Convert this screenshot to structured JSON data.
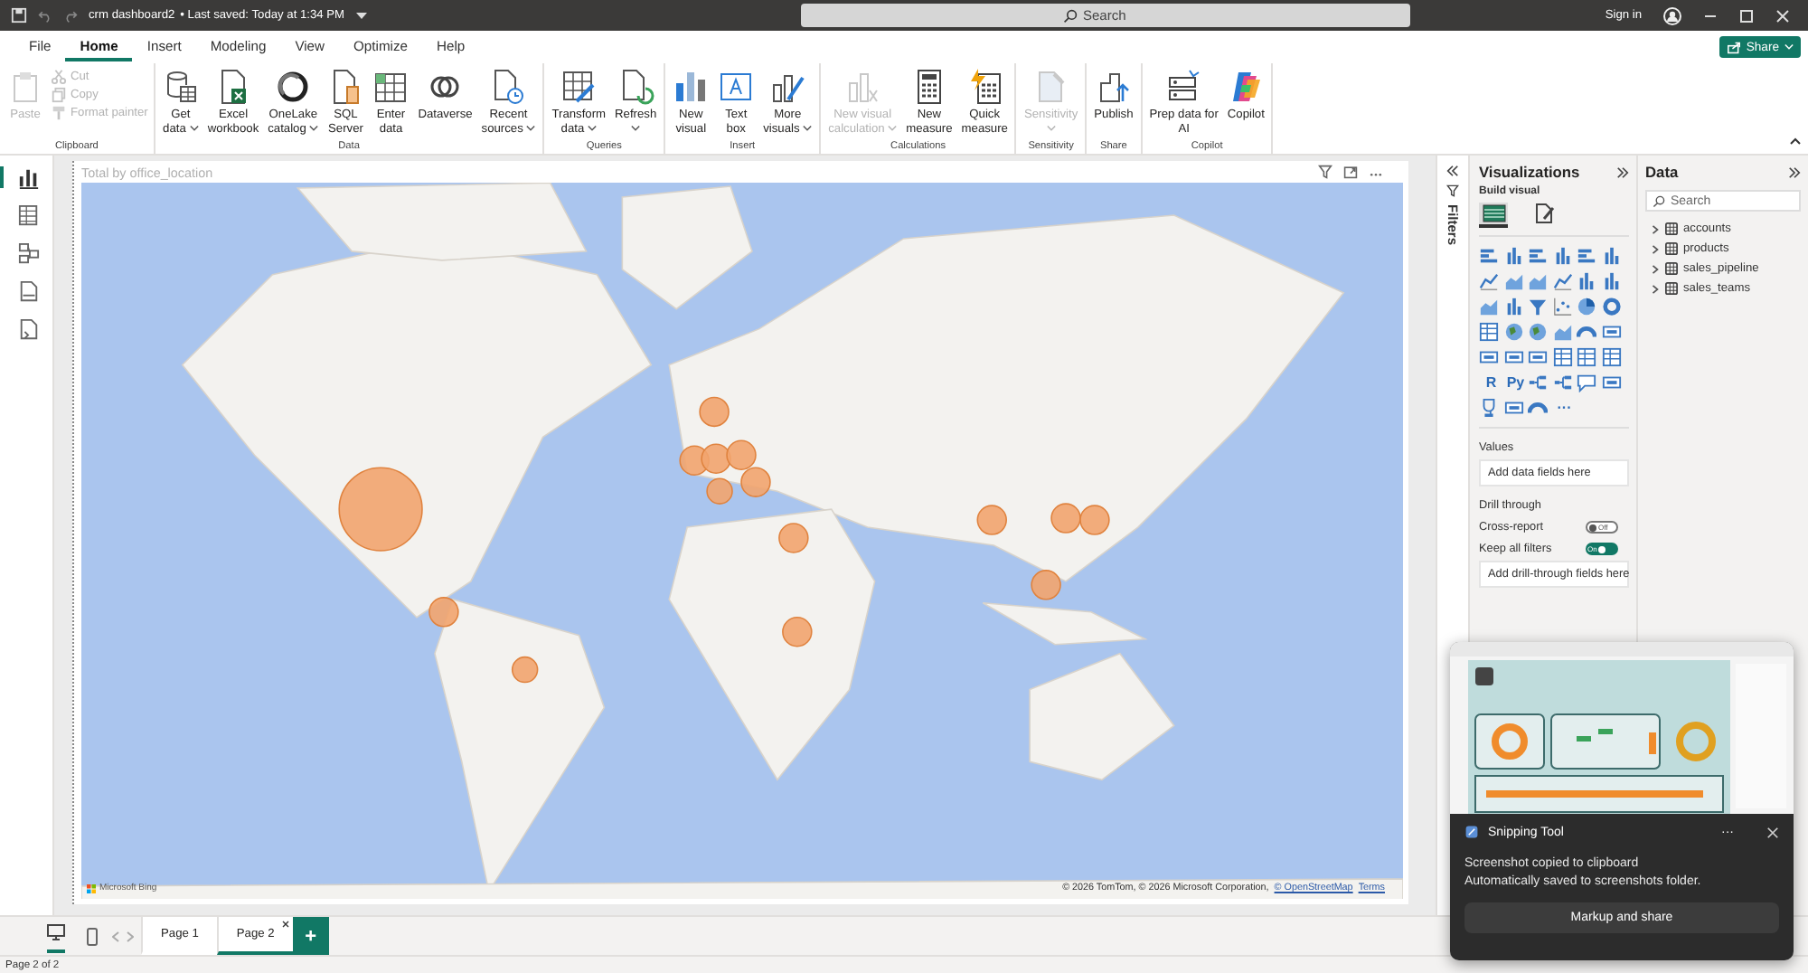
{
  "title_bar": {
    "file_name": "crm dashboard2",
    "save_status": "• Last saved: Today at 1:34 PM",
    "search": {
      "placeholder": "Search"
    },
    "sign_in": "Sign in"
  },
  "menu_tabs": [
    {
      "label": "File",
      "selected": false
    },
    {
      "label": "Home",
      "selected": true
    },
    {
      "label": "Insert",
      "selected": false
    },
    {
      "label": "Modeling",
      "selected": false
    },
    {
      "label": "View",
      "selected": false
    },
    {
      "label": "Optimize",
      "selected": false
    },
    {
      "label": "Help",
      "selected": false
    }
  ],
  "share_button": "Share",
  "ribbon": [
    {
      "label": "Clipboard",
      "items": [
        {
          "kind": "large",
          "lines": [
            "Paste"
          ],
          "dropdown": false,
          "disabled": true
        },
        {
          "kind": "small",
          "lines": [
            "Cut"
          ],
          "dropdown": false,
          "disabled": true
        },
        {
          "kind": "small",
          "lines": [
            "Copy"
          ],
          "dropdown": false,
          "disabled": true
        },
        {
          "kind": "small",
          "lines": [
            "Format painter"
          ],
          "dropdown": false,
          "disabled": true
        }
      ]
    },
    {
      "label": "Data",
      "items": [
        {
          "kind": "large",
          "lines": [
            "Get",
            "data"
          ],
          "dropdown": true,
          "disabled": false
        },
        {
          "kind": "large",
          "lines": [
            "Excel",
            "workbook"
          ],
          "dropdown": false,
          "disabled": false
        },
        {
          "kind": "large",
          "lines": [
            "OneLake",
            "catalog"
          ],
          "dropdown": true,
          "disabled": false
        },
        {
          "kind": "large",
          "lines": [
            "SQL",
            "Server"
          ],
          "dropdown": false,
          "disabled": false
        },
        {
          "kind": "large",
          "lines": [
            "Enter",
            "data"
          ],
          "dropdown": false,
          "disabled": false
        },
        {
          "kind": "large",
          "lines": [
            "Dataverse"
          ],
          "dropdown": false,
          "disabled": false
        },
        {
          "kind": "large",
          "lines": [
            "Recent",
            "sources"
          ],
          "dropdown": true,
          "disabled": false
        }
      ]
    },
    {
      "label": "Queries",
      "items": [
        {
          "kind": "large",
          "lines": [
            "Transform",
            "data"
          ],
          "dropdown": true,
          "disabled": false
        },
        {
          "kind": "large",
          "lines": [
            "Refresh"
          ],
          "dropdown": true,
          "disabled": false
        }
      ]
    },
    {
      "label": "Insert",
      "items": [
        {
          "kind": "large",
          "lines": [
            "New",
            "visual"
          ],
          "dropdown": false,
          "disabled": false
        },
        {
          "kind": "large",
          "lines": [
            "Text",
            "box"
          ],
          "dropdown": false,
          "disabled": false
        },
        {
          "kind": "large",
          "lines": [
            "More",
            "visuals"
          ],
          "dropdown": true,
          "disabled": false
        }
      ]
    },
    {
      "label": "Calculations",
      "items": [
        {
          "kind": "large",
          "lines": [
            "New visual",
            "calculation"
          ],
          "dropdown": true,
          "disabled": true
        },
        {
          "kind": "large",
          "lines": [
            "New",
            "measure"
          ],
          "dropdown": false,
          "disabled": false
        },
        {
          "kind": "large",
          "lines": [
            "Quick",
            "measure"
          ],
          "dropdown": false,
          "disabled": false
        }
      ]
    },
    {
      "label": "Sensitivity",
      "items": [
        {
          "kind": "large",
          "lines": [
            "Sensitivity"
          ],
          "dropdown": true,
          "disabled": true
        }
      ]
    },
    {
      "label": "Share",
      "items": [
        {
          "kind": "large",
          "lines": [
            "Publish"
          ],
          "dropdown": false,
          "disabled": false
        }
      ]
    },
    {
      "label": "Copilot",
      "items": [
        {
          "kind": "large",
          "lines": [
            "Prep data for",
            "AI"
          ],
          "dropdown": false,
          "disabled": false
        },
        {
          "kind": "large",
          "lines": [
            "Copilot"
          ],
          "dropdown": false,
          "disabled": false
        }
      ]
    }
  ],
  "view_rail": [
    {
      "selected": true
    },
    {
      "selected": false
    },
    {
      "selected": false
    },
    {
      "selected": false
    },
    {
      "selected": false
    }
  ],
  "visual": {
    "title": "Total by office_location",
    "map": {
      "kind": "picture"
    },
    "provider": "Microsoft Bing",
    "credits": "© 2026 TomTom, © 2026 Microsoft Corporation,",
    "links": [
      "© OpenStreetMap",
      "Terms"
    ]
  },
  "filters_pane": {
    "label": "Filters"
  },
  "visualizations": {
    "title": "Visualizations",
    "subtitle": "Build visual",
    "modes": [
      {
        "selected": true
      },
      {
        "selected": false
      }
    ],
    "gallery": [
      {
        "kind": "icon"
      },
      {
        "kind": "icon"
      },
      {
        "kind": "icon"
      },
      {
        "kind": "icon"
      },
      {
        "kind": "icon"
      },
      {
        "kind": "icon"
      },
      {
        "kind": "icon"
      },
      {
        "kind": "icon"
      },
      {
        "kind": "icon"
      },
      {
        "kind": "icon"
      },
      {
        "kind": "icon"
      },
      {
        "kind": "icon"
      },
      {
        "kind": "icon"
      },
      {
        "kind": "icon"
      },
      {
        "kind": "icon"
      },
      {
        "kind": "icon"
      },
      {
        "kind": "icon"
      },
      {
        "kind": "icon"
      },
      {
        "kind": "icon"
      },
      {
        "kind": "icon"
      },
      {
        "kind": "icon"
      },
      {
        "kind": "icon"
      },
      {
        "kind": "icon"
      },
      {
        "kind": "icon"
      },
      {
        "kind": "icon"
      },
      {
        "kind": "icon"
      },
      {
        "kind": "icon"
      },
      {
        "kind": "icon"
      },
      {
        "kind": "icon"
      },
      {
        "kind": "icon"
      },
      {
        "kind": "text",
        "text": "R"
      },
      {
        "kind": "text",
        "text": "Py"
      },
      {
        "kind": "icon"
      },
      {
        "kind": "icon"
      },
      {
        "kind": "icon"
      },
      {
        "kind": "icon"
      },
      {
        "kind": "icon"
      },
      {
        "kind": "icon"
      },
      {
        "kind": "icon"
      },
      {
        "kind": "text",
        "text": "···"
      }
    ],
    "values_label": "Values",
    "values_well": "Add data fields here",
    "drill_label": "Drill through",
    "toggles": [
      {
        "label": "Cross-report",
        "on": false,
        "text": "Off"
      },
      {
        "label": "Keep all filters",
        "on": true,
        "text": "On"
      }
    ],
    "drill_well": "Add drill-through fields here"
  },
  "data_pane": {
    "title": "Data",
    "search": {
      "placeholder": "Search"
    },
    "tables": [
      {
        "name": "accounts",
        "expanded": false
      },
      {
        "name": "products",
        "expanded": false
      },
      {
        "name": "sales_pipeline",
        "expanded": false
      },
      {
        "name": "sales_teams",
        "expanded": false
      }
    ]
  },
  "page_bar": {
    "pages": [
      {
        "label": "Page 1",
        "selected": false
      },
      {
        "label": "Page 2",
        "selected": true
      }
    ],
    "add_button": "+"
  },
  "status_bar": "Page 2 of 2",
  "toast": {
    "preview": {
      "kind": "picture"
    },
    "app": "Snipping Tool",
    "more": "···",
    "title": "Screenshot copied to clipboard",
    "message": "Automatically saved to screenshots folder.",
    "action": "Markup and share"
  }
}
